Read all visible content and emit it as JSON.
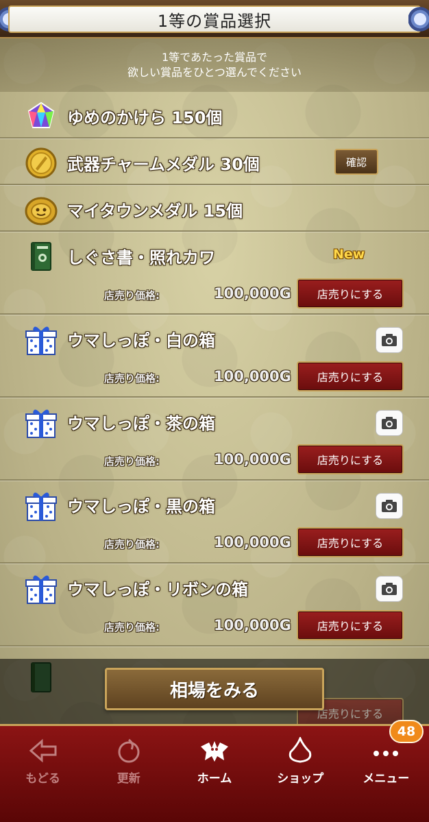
{
  "header": {
    "title": "1等の賞品選択"
  },
  "instruction": {
    "line1": "1等であたった賞品で",
    "line2": "欲しい賞品をひとつ選んでください"
  },
  "items": [
    {
      "name": "ゆめのかけら 150個",
      "icon": "gem-icon"
    },
    {
      "name": "武器チャームメダル 30個",
      "icon": "gold-medal-icon",
      "confirm_label": "確認"
    },
    {
      "name": "マイタウンメダル 15個",
      "icon": "town-medal-icon"
    },
    {
      "name": "しぐさ書・照れカワ",
      "icon": "book-icon",
      "badge": "New",
      "price_label": "店売り価格:",
      "price": "100,000G",
      "sell_label": "店売りにする"
    },
    {
      "name": "ウマしっぽ・白の箱",
      "icon": "gift-box-icon",
      "price_label": "店売り価格:",
      "price": "100,000G",
      "sell_label": "店売りにする"
    },
    {
      "name": "ウマしっぽ・茶の箱",
      "icon": "gift-box-icon",
      "price_label": "店売り価格:",
      "price": "100,000G",
      "sell_label": "店売りにする"
    },
    {
      "name": "ウマしっぽ・黒の箱",
      "icon": "gift-box-icon",
      "price_label": "店売り価格:",
      "price": "100,000G",
      "sell_label": "店売りにする"
    },
    {
      "name": "ウマしっぽ・リボンの箱",
      "icon": "gift-box-icon",
      "price_label": "店売り価格:",
      "price": "100,000G",
      "sell_label": "店売りにする"
    }
  ],
  "peek": {
    "sell_label": "店売りにする"
  },
  "market_button": {
    "label": "相場をみる"
  },
  "nav": {
    "back": "もどる",
    "refresh": "更新",
    "home": "ホーム",
    "shop": "ショップ",
    "menu": "メニュー",
    "menu_badge": "48"
  }
}
